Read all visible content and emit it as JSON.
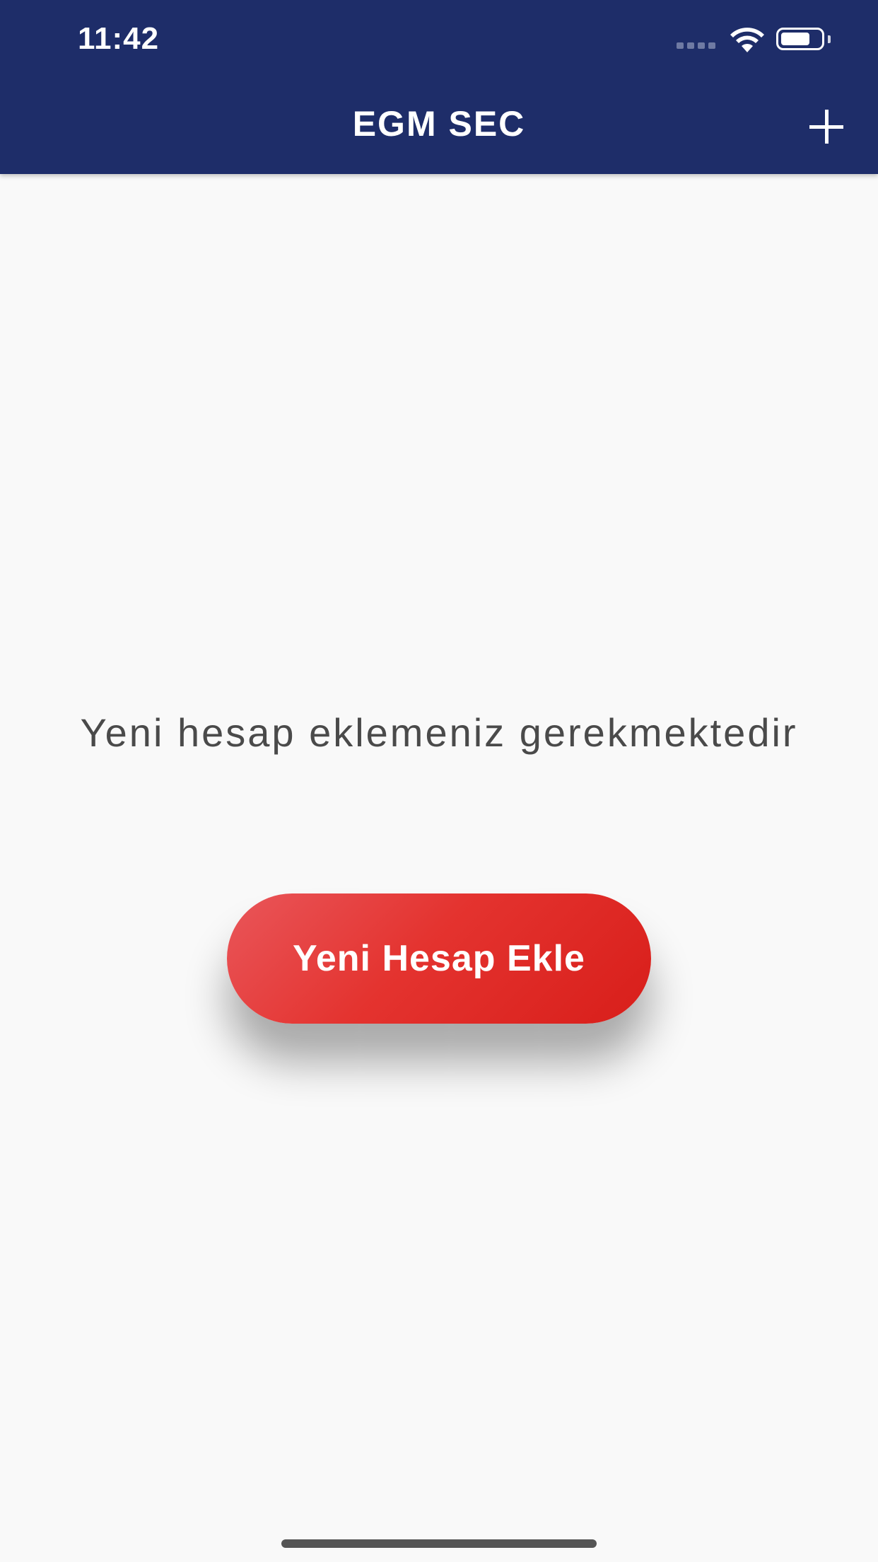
{
  "status_bar": {
    "time": "11:42"
  },
  "nav_bar": {
    "title": "EGM SEC",
    "add_icon": "plus-icon",
    "background_color": "#1e2d69"
  },
  "main": {
    "empty_message": "Yeni hesap eklemeniz gerekmektedir",
    "add_button_label": "Yeni Hesap Ekle",
    "button_color": "#e02a27"
  }
}
